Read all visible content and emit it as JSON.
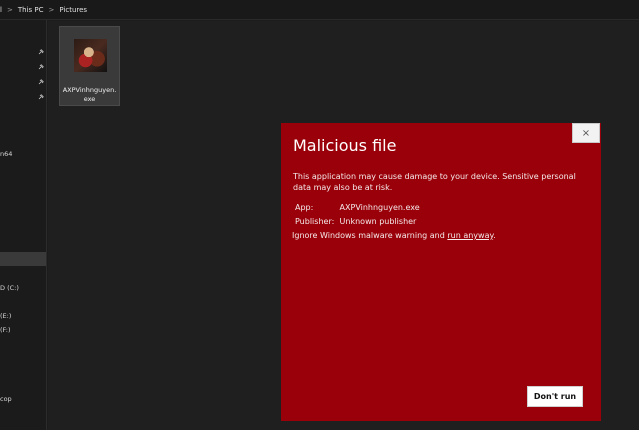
{
  "breadcrumb": {
    "root": "l",
    "this_pc": "This PC",
    "pictures": "Pictures",
    "sep": ">"
  },
  "sidebar": {
    "items": [
      {
        "label": "n64"
      },
      {
        "label": "D (C:)"
      },
      {
        "label": "(E:)"
      },
      {
        "label": "(F:)"
      },
      {
        "label": "cop"
      }
    ]
  },
  "file": {
    "name": "AXPVinhnguyen.exe",
    "name_line1": "AXPVinhnguyen.",
    "name_line2": "exe"
  },
  "dialog": {
    "close_glyph": "×",
    "title": "Malicious file",
    "message": "This application may cause damage to your device. Sensitive personal data may also be at risk.",
    "app_label": "App:",
    "app_value": "AXPVinhnguyen.exe",
    "publisher_label": "Publisher:",
    "publisher_value": "Unknown publisher",
    "ignore_text": "Ignore Windows malware warning and ",
    "ignore_link": "run anyway",
    "ignore_end": ".",
    "dont_run_label": "Don't run",
    "background_color": "#9a0009"
  }
}
